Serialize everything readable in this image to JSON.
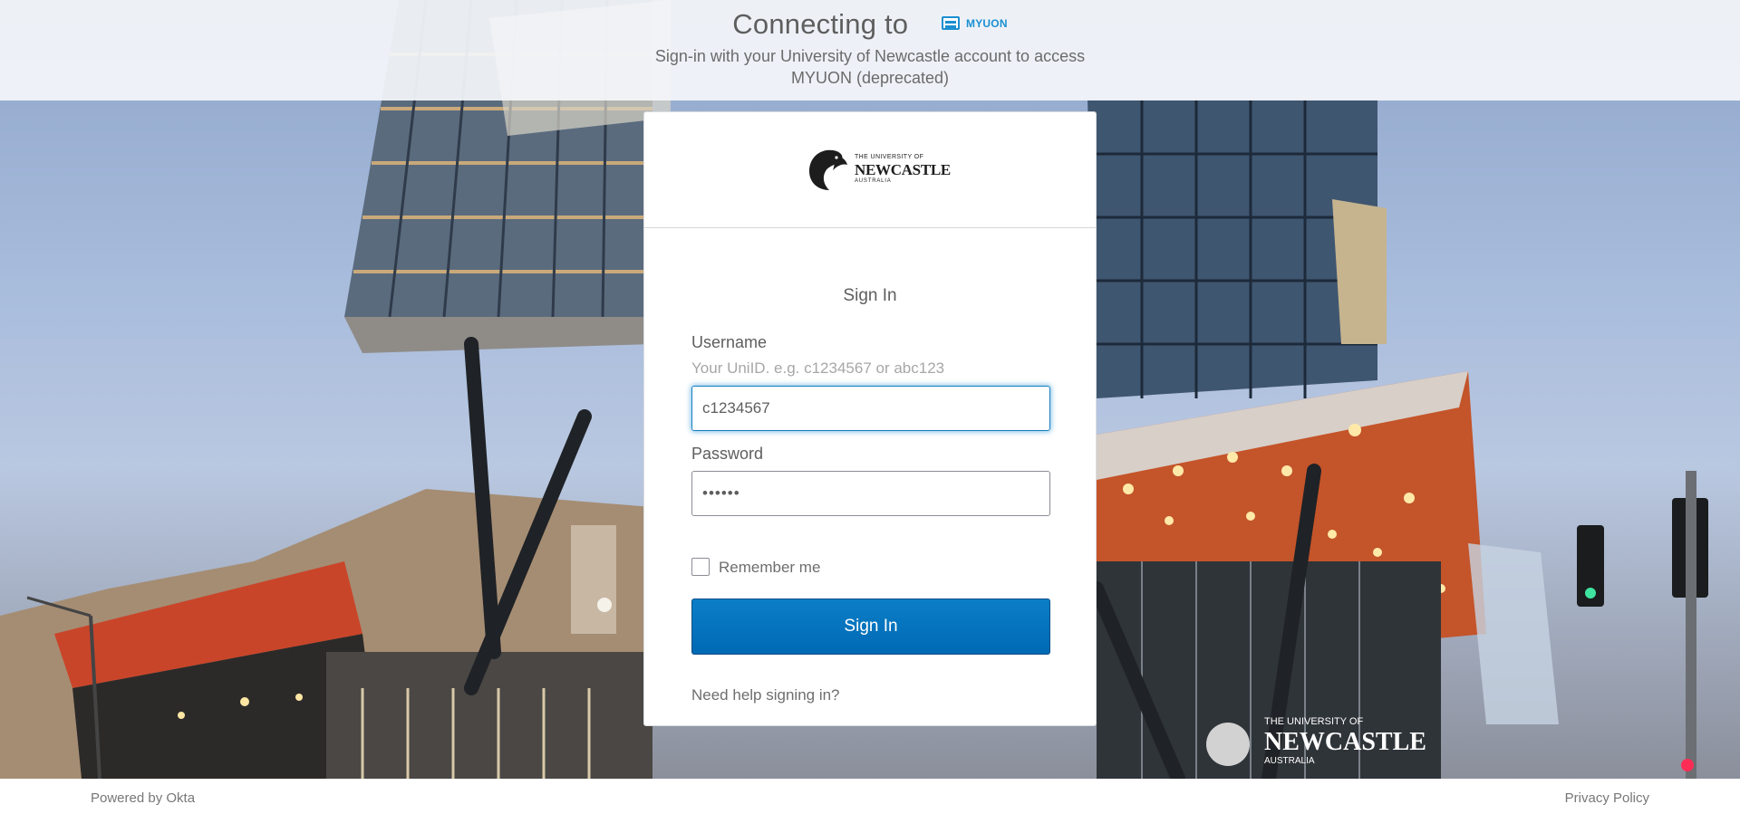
{
  "header": {
    "connecting_to": "Connecting to",
    "app_name": "MYUON",
    "subtitle": "Sign-in with your University of Newcastle account to access MYUON (deprecated)"
  },
  "card": {
    "logo": {
      "line1": "THE UNIVERSITY OF",
      "line2": "NEWCASTLE",
      "line3": "AUSTRALIA"
    },
    "title": "Sign In",
    "username": {
      "label": "Username",
      "hint": "Your UniID. e.g. c1234567 or abc123",
      "value": "c1234567"
    },
    "password": {
      "label": "Password",
      "value": "••••••"
    },
    "remember_me": {
      "label": "Remember me",
      "checked": false
    },
    "submit_label": "Sign In",
    "help_link": "Need help signing in?"
  },
  "background": {
    "building_sign_line1": "THE UNIVERSITY OF",
    "building_sign_line2": "NEWCASTLE",
    "building_sign_line3": "AUSTRALIA"
  },
  "footer": {
    "powered_by": "Powered by Okta",
    "privacy": "Privacy Policy"
  },
  "colors": {
    "primary_button": "#0074be",
    "focus_ring": "#1b8cd2",
    "app_logo": "#1b8fd1"
  }
}
